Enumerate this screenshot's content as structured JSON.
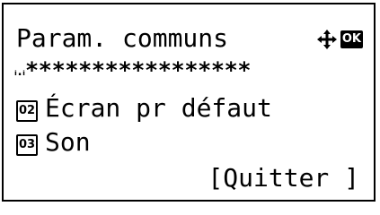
{
  "screen": {
    "title": "Param. communs",
    "nav_icon": "four-way-arrow-icon",
    "ok_label": "OK",
    "stars_lead": "ᵢ․ᵢ",
    "stars": "*****************",
    "items": [
      {
        "number": "02",
        "label": "Écran pr défaut"
      },
      {
        "number": "03",
        "label": "Son"
      }
    ],
    "quit_label": "[Quitter ]"
  }
}
